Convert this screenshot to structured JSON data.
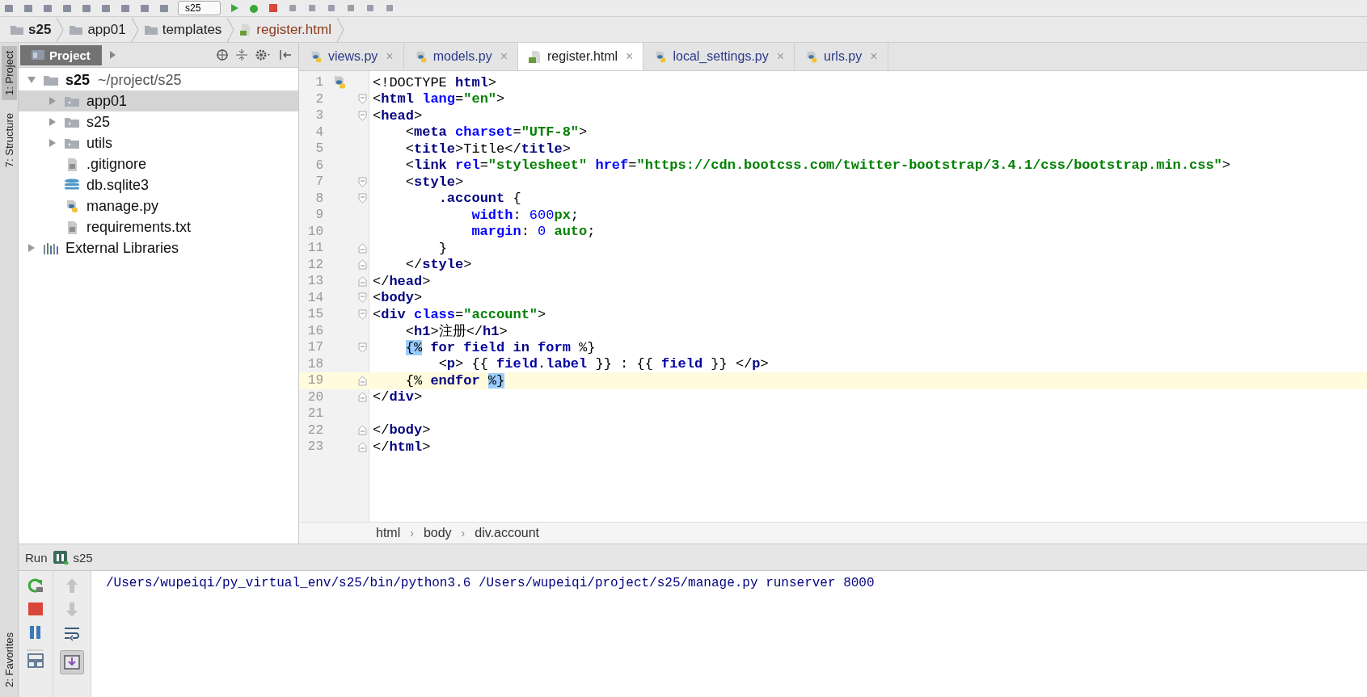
{
  "toolbar": {
    "run_config": "s25"
  },
  "navbar": [
    {
      "label": "s25",
      "kind": "project"
    },
    {
      "label": "app01",
      "kind": "folder"
    },
    {
      "label": "templates",
      "kind": "folder"
    },
    {
      "label": "register.html",
      "kind": "html"
    }
  ],
  "side_tabs": [
    {
      "label": "1: Project",
      "selected": true
    },
    {
      "label": "7: Structure",
      "selected": false
    }
  ],
  "bottom_side_tab": "2: Favorites",
  "project_panel": {
    "title": "Project",
    "tree": [
      {
        "label": "s25",
        "path": "~/project/s25",
        "kind": "root",
        "expanded": true,
        "selected": false,
        "children": [
          {
            "label": "app01",
            "kind": "folder",
            "expanded": false,
            "selected": true
          },
          {
            "label": "s25",
            "kind": "folder",
            "expanded": false,
            "selected": false
          },
          {
            "label": "utils",
            "kind": "folder",
            "expanded": false,
            "selected": false
          },
          {
            "label": ".gitignore",
            "kind": "text",
            "selected": false
          },
          {
            "label": "db.sqlite3",
            "kind": "db",
            "selected": false
          },
          {
            "label": "manage.py",
            "kind": "python",
            "selected": false
          },
          {
            "label": "requirements.txt",
            "kind": "text",
            "selected": false
          }
        ]
      },
      {
        "label": "External Libraries",
        "kind": "libraries",
        "expanded": false,
        "selected": false
      }
    ]
  },
  "tabs": [
    {
      "label": "views.py",
      "kind": "python",
      "selected": false
    },
    {
      "label": "models.py",
      "kind": "python",
      "selected": false
    },
    {
      "label": "register.html",
      "kind": "html",
      "selected": true
    },
    {
      "label": "local_settings.py",
      "kind": "python",
      "selected": false
    },
    {
      "label": "urls.py",
      "kind": "python",
      "selected": false
    }
  ],
  "close_glyph": "×",
  "editor": {
    "lines": [
      {
        "number": "1",
        "fold_open": false,
        "fold_close": false,
        "current": false,
        "gutter_icon": true,
        "tokens": [
          {
            "kind": "plain",
            "text": "<!DOCTYPE "
          },
          {
            "kind": "tag",
            "text": "html"
          },
          {
            "kind": "plain",
            "text": ">"
          }
        ]
      },
      {
        "number": "2",
        "fold_open": true,
        "fold_close": false,
        "current": false,
        "tokens": [
          {
            "kind": "plain",
            "text": "<"
          },
          {
            "kind": "tag",
            "text": "html "
          },
          {
            "kind": "attr",
            "text": "lang"
          },
          {
            "kind": "plain",
            "text": "="
          },
          {
            "kind": "string",
            "text": "\"en\""
          },
          {
            "kind": "plain",
            "text": ">"
          }
        ]
      },
      {
        "number": "3",
        "fold_open": true,
        "fold_close": false,
        "current": false,
        "tokens": [
          {
            "kind": "plain",
            "text": "<"
          },
          {
            "kind": "tag",
            "text": "head"
          },
          {
            "kind": "plain",
            "text": ">"
          }
        ]
      },
      {
        "number": "4",
        "fold_open": false,
        "fold_close": false,
        "current": false,
        "tokens": [
          {
            "kind": "plain",
            "text": "    <"
          },
          {
            "kind": "tag",
            "text": "meta "
          },
          {
            "kind": "attr",
            "text": "charset"
          },
          {
            "kind": "plain",
            "text": "="
          },
          {
            "kind": "string",
            "text": "\"UTF-8\""
          },
          {
            "kind": "plain",
            "text": ">"
          }
        ]
      },
      {
        "number": "5",
        "fold_open": false,
        "fold_close": false,
        "current": false,
        "tokens": [
          {
            "kind": "plain",
            "text": "    <"
          },
          {
            "kind": "tag",
            "text": "title"
          },
          {
            "kind": "plain",
            "text": ">"
          },
          {
            "kind": "text",
            "text": "Title"
          },
          {
            "kind": "plain",
            "text": "</"
          },
          {
            "kind": "tag",
            "text": "title"
          },
          {
            "kind": "plain",
            "text": ">"
          }
        ]
      },
      {
        "number": "6",
        "fold_open": false,
        "fold_close": false,
        "current": false,
        "tokens": [
          {
            "kind": "plain",
            "text": "    <"
          },
          {
            "kind": "tag",
            "text": "link "
          },
          {
            "kind": "attr",
            "text": "rel"
          },
          {
            "kind": "plain",
            "text": "="
          },
          {
            "kind": "string",
            "text": "\"stylesheet\""
          },
          {
            "kind": "attr",
            "text": " href"
          },
          {
            "kind": "plain",
            "text": "="
          },
          {
            "kind": "string",
            "text": "\"https://cdn.bootcss.com/twitter-bootstrap/3.4.1/css/bootstrap.min.css\""
          },
          {
            "kind": "plain",
            "text": ">"
          }
        ]
      },
      {
        "number": "7",
        "fold_open": true,
        "fold_close": false,
        "current": false,
        "tokens": [
          {
            "kind": "plain",
            "text": "    <"
          },
          {
            "kind": "tag",
            "text": "style"
          },
          {
            "kind": "plain",
            "text": ">"
          }
        ]
      },
      {
        "number": "8",
        "fold_open": true,
        "fold_close": false,
        "current": false,
        "tokens": [
          {
            "kind": "tag",
            "text": "        .account"
          },
          {
            "kind": "text",
            "text": " {"
          }
        ]
      },
      {
        "number": "9",
        "fold_open": false,
        "fold_close": false,
        "current": false,
        "tokens": [
          {
            "kind": "prop",
            "text": "            width"
          },
          {
            "kind": "text",
            "text": ": "
          },
          {
            "kind": "number",
            "text": "600"
          },
          {
            "kind": "string",
            "text": "px"
          },
          {
            "kind": "text",
            "text": ";"
          }
        ]
      },
      {
        "number": "10",
        "fold_open": false,
        "fold_close": false,
        "current": false,
        "tokens": [
          {
            "kind": "prop",
            "text": "            margin"
          },
          {
            "kind": "text",
            "text": ": "
          },
          {
            "kind": "number",
            "text": "0"
          },
          {
            "kind": "string",
            "text": " auto"
          },
          {
            "kind": "text",
            "text": ";"
          }
        ]
      },
      {
        "number": "11",
        "fold_open": false,
        "fold_close": true,
        "current": false,
        "tokens": [
          {
            "kind": "text",
            "text": "        }"
          }
        ]
      },
      {
        "number": "12",
        "fold_open": false,
        "fold_close": true,
        "current": false,
        "tokens": [
          {
            "kind": "plain",
            "text": "    </"
          },
          {
            "kind": "tag",
            "text": "style"
          },
          {
            "kind": "plain",
            "text": ">"
          }
        ]
      },
      {
        "number": "13",
        "fold_open": false,
        "fold_close": true,
        "current": false,
        "tokens": [
          {
            "kind": "plain",
            "text": "</"
          },
          {
            "kind": "tag",
            "text": "head"
          },
          {
            "kind": "plain",
            "text": ">"
          }
        ]
      },
      {
        "number": "14",
        "fold_open": true,
        "fold_close": false,
        "current": false,
        "tokens": [
          {
            "kind": "plain",
            "text": "<"
          },
          {
            "kind": "tag",
            "text": "body"
          },
          {
            "kind": "plain",
            "text": ">"
          }
        ]
      },
      {
        "number": "15",
        "fold_open": true,
        "fold_close": false,
        "current": false,
        "tokens": [
          {
            "kind": "plain",
            "text": "<"
          },
          {
            "kind": "tag",
            "text": "div "
          },
          {
            "kind": "attr",
            "text": "class"
          },
          {
            "kind": "plain",
            "text": "="
          },
          {
            "kind": "string",
            "text": "\"account\""
          },
          {
            "kind": "plain",
            "text": ">"
          }
        ]
      },
      {
        "number": "16",
        "fold_open": false,
        "fold_close": false,
        "current": false,
        "tokens": [
          {
            "kind": "plain",
            "text": "    <"
          },
          {
            "kind": "tag",
            "text": "h1"
          },
          {
            "kind": "plain",
            "text": ">"
          },
          {
            "kind": "text",
            "text": "注册"
          },
          {
            "kind": "plain",
            "text": "</"
          },
          {
            "kind": "tag",
            "text": "h1"
          },
          {
            "kind": "plain",
            "text": ">"
          }
        ]
      },
      {
        "number": "17",
        "fold_open": true,
        "fold_close": false,
        "current": false,
        "tokens": [
          {
            "kind": "match",
            "text": "    {%"
          },
          {
            "kind": "keyword",
            "text": " for"
          },
          {
            "kind": "var",
            "text": " field"
          },
          {
            "kind": "keyword",
            "text": " in"
          },
          {
            "kind": "var",
            "text": " form"
          },
          {
            "kind": "text",
            "text": " %}"
          }
        ]
      },
      {
        "number": "18",
        "fold_open": false,
        "fold_close": false,
        "current": false,
        "tokens": [
          {
            "kind": "plain",
            "text": "        <"
          },
          {
            "kind": "tag",
            "text": "p"
          },
          {
            "kind": "plain",
            "text": "> {{ "
          },
          {
            "kind": "var",
            "text": "field"
          },
          {
            "kind": "plain",
            "text": "."
          },
          {
            "kind": "var",
            "text": "label"
          },
          {
            "kind": "plain",
            "text": " }} : {{ "
          },
          {
            "kind": "var",
            "text": "field"
          },
          {
            "kind": "plain",
            "text": " }} </"
          },
          {
            "kind": "tag",
            "text": "p"
          },
          {
            "kind": "plain",
            "text": ">"
          }
        ]
      },
      {
        "number": "19",
        "fold_open": false,
        "fold_close": true,
        "current": true,
        "tokens": [
          {
            "kind": "text",
            "text": "    {% "
          },
          {
            "kind": "keyword",
            "text": "endfor"
          },
          {
            "kind": "match",
            "text": " %}"
          }
        ]
      },
      {
        "number": "20",
        "fold_open": false,
        "fold_close": true,
        "current": false,
        "tokens": [
          {
            "kind": "plain",
            "text": "</"
          },
          {
            "kind": "tag",
            "text": "div"
          },
          {
            "kind": "plain",
            "text": ">"
          }
        ]
      },
      {
        "number": "21",
        "fold_open": false,
        "fold_close": false,
        "current": false
      },
      {
        "number": "22",
        "fold_open": false,
        "fold_close": true,
        "current": false,
        "tokens": [
          {
            "kind": "plain",
            "text": "</"
          },
          {
            "kind": "tag",
            "text": "body"
          },
          {
            "kind": "plain",
            "text": ">"
          }
        ]
      },
      {
        "number": "23",
        "fold_open": false,
        "fold_close": true,
        "current": false,
        "tokens": [
          {
            "kind": "plain",
            "text": "</"
          },
          {
            "kind": "tag",
            "text": "html"
          },
          {
            "kind": "plain",
            "text": ">"
          }
        ]
      }
    ],
    "breadcrumbs": [
      "html",
      "body",
      "div.account"
    ],
    "breadcrumb_separator": "›"
  },
  "run_panel": {
    "label": "Run",
    "config": "s25",
    "console": "/Users/wupeiqi/py_virtual_env/s25/bin/python3.6 /Users/wupeiqi/project/s25/manage.py runserver 8000"
  }
}
